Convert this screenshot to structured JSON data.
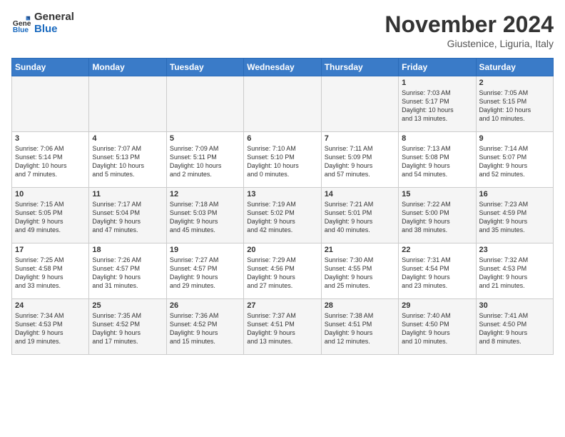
{
  "logo": {
    "general": "General",
    "blue": "Blue"
  },
  "title": "November 2024",
  "location": "Giustenice, Liguria, Italy",
  "headers": [
    "Sunday",
    "Monday",
    "Tuesday",
    "Wednesday",
    "Thursday",
    "Friday",
    "Saturday"
  ],
  "weeks": [
    [
      {
        "day": "",
        "info": ""
      },
      {
        "day": "",
        "info": ""
      },
      {
        "day": "",
        "info": ""
      },
      {
        "day": "",
        "info": ""
      },
      {
        "day": "",
        "info": ""
      },
      {
        "day": "1",
        "info": "Sunrise: 7:03 AM\nSunset: 5:17 PM\nDaylight: 10 hours\nand 13 minutes."
      },
      {
        "day": "2",
        "info": "Sunrise: 7:05 AM\nSunset: 5:15 PM\nDaylight: 10 hours\nand 10 minutes."
      }
    ],
    [
      {
        "day": "3",
        "info": "Sunrise: 7:06 AM\nSunset: 5:14 PM\nDaylight: 10 hours\nand 7 minutes."
      },
      {
        "day": "4",
        "info": "Sunrise: 7:07 AM\nSunset: 5:13 PM\nDaylight: 10 hours\nand 5 minutes."
      },
      {
        "day": "5",
        "info": "Sunrise: 7:09 AM\nSunset: 5:11 PM\nDaylight: 10 hours\nand 2 minutes."
      },
      {
        "day": "6",
        "info": "Sunrise: 7:10 AM\nSunset: 5:10 PM\nDaylight: 10 hours\nand 0 minutes."
      },
      {
        "day": "7",
        "info": "Sunrise: 7:11 AM\nSunset: 5:09 PM\nDaylight: 9 hours\nand 57 minutes."
      },
      {
        "day": "8",
        "info": "Sunrise: 7:13 AM\nSunset: 5:08 PM\nDaylight: 9 hours\nand 54 minutes."
      },
      {
        "day": "9",
        "info": "Sunrise: 7:14 AM\nSunset: 5:07 PM\nDaylight: 9 hours\nand 52 minutes."
      }
    ],
    [
      {
        "day": "10",
        "info": "Sunrise: 7:15 AM\nSunset: 5:05 PM\nDaylight: 9 hours\nand 49 minutes."
      },
      {
        "day": "11",
        "info": "Sunrise: 7:17 AM\nSunset: 5:04 PM\nDaylight: 9 hours\nand 47 minutes."
      },
      {
        "day": "12",
        "info": "Sunrise: 7:18 AM\nSunset: 5:03 PM\nDaylight: 9 hours\nand 45 minutes."
      },
      {
        "day": "13",
        "info": "Sunrise: 7:19 AM\nSunset: 5:02 PM\nDaylight: 9 hours\nand 42 minutes."
      },
      {
        "day": "14",
        "info": "Sunrise: 7:21 AM\nSunset: 5:01 PM\nDaylight: 9 hours\nand 40 minutes."
      },
      {
        "day": "15",
        "info": "Sunrise: 7:22 AM\nSunset: 5:00 PM\nDaylight: 9 hours\nand 38 minutes."
      },
      {
        "day": "16",
        "info": "Sunrise: 7:23 AM\nSunset: 4:59 PM\nDaylight: 9 hours\nand 35 minutes."
      }
    ],
    [
      {
        "day": "17",
        "info": "Sunrise: 7:25 AM\nSunset: 4:58 PM\nDaylight: 9 hours\nand 33 minutes."
      },
      {
        "day": "18",
        "info": "Sunrise: 7:26 AM\nSunset: 4:57 PM\nDaylight: 9 hours\nand 31 minutes."
      },
      {
        "day": "19",
        "info": "Sunrise: 7:27 AM\nSunset: 4:57 PM\nDaylight: 9 hours\nand 29 minutes."
      },
      {
        "day": "20",
        "info": "Sunrise: 7:29 AM\nSunset: 4:56 PM\nDaylight: 9 hours\nand 27 minutes."
      },
      {
        "day": "21",
        "info": "Sunrise: 7:30 AM\nSunset: 4:55 PM\nDaylight: 9 hours\nand 25 minutes."
      },
      {
        "day": "22",
        "info": "Sunrise: 7:31 AM\nSunset: 4:54 PM\nDaylight: 9 hours\nand 23 minutes."
      },
      {
        "day": "23",
        "info": "Sunrise: 7:32 AM\nSunset: 4:53 PM\nDaylight: 9 hours\nand 21 minutes."
      }
    ],
    [
      {
        "day": "24",
        "info": "Sunrise: 7:34 AM\nSunset: 4:53 PM\nDaylight: 9 hours\nand 19 minutes."
      },
      {
        "day": "25",
        "info": "Sunrise: 7:35 AM\nSunset: 4:52 PM\nDaylight: 9 hours\nand 17 minutes."
      },
      {
        "day": "26",
        "info": "Sunrise: 7:36 AM\nSunset: 4:52 PM\nDaylight: 9 hours\nand 15 minutes."
      },
      {
        "day": "27",
        "info": "Sunrise: 7:37 AM\nSunset: 4:51 PM\nDaylight: 9 hours\nand 13 minutes."
      },
      {
        "day": "28",
        "info": "Sunrise: 7:38 AM\nSunset: 4:51 PM\nDaylight: 9 hours\nand 12 minutes."
      },
      {
        "day": "29",
        "info": "Sunrise: 7:40 AM\nSunset: 4:50 PM\nDaylight: 9 hours\nand 10 minutes."
      },
      {
        "day": "30",
        "info": "Sunrise: 7:41 AM\nSunset: 4:50 PM\nDaylight: 9 hours\nand 8 minutes."
      }
    ]
  ]
}
